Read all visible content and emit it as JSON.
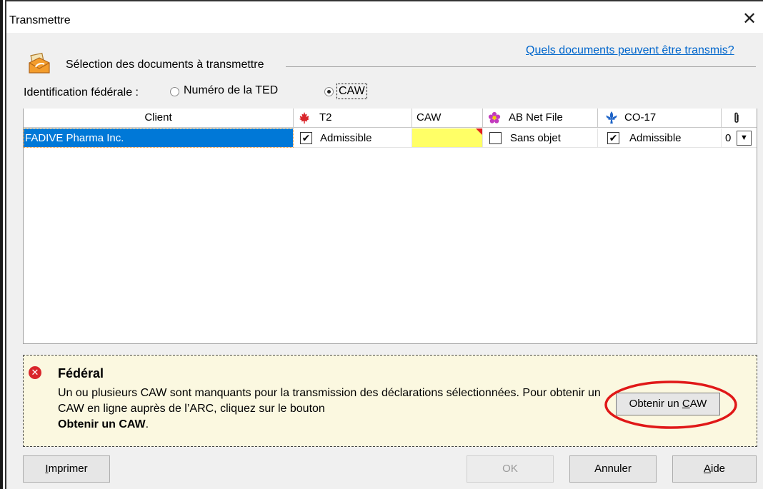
{
  "window": {
    "title": "Transmettre",
    "close_glyph": "✕"
  },
  "section": {
    "title": "Sélection des documents à transmettre",
    "help_link": "Quels documents peuvent être transmis?"
  },
  "identification": {
    "label": "Identification fédérale :",
    "options": [
      "Numéro de la TED",
      "CAW"
    ],
    "selected": "CAW"
  },
  "grid": {
    "headers": {
      "client": "Client",
      "t2": "T2",
      "caw": "CAW",
      "ab_net_file": "AB Net File",
      "co17": "CO-17",
      "attachments_icon": "paperclip-icon"
    },
    "rows": [
      {
        "client": "FADIVE Pharma Inc.",
        "t2_checked": true,
        "t2_status": "Admissible",
        "caw": "",
        "ab_checked": false,
        "ab_status": "Sans objet",
        "co17_checked": true,
        "co17_status": "Admissible",
        "attachments": "0"
      }
    ],
    "colors": {
      "selected_row": "#0078d7",
      "caw_missing": "#ffff66",
      "caw_marker": "#e02020"
    }
  },
  "warning": {
    "title": "Fédéral",
    "message": "Un ou plusieurs CAW sont manquants pour la transmission des déclarations sélectionnées. Pour obtenir un CAW en ligne auprès de l’ARC, cliquez sur le bouton",
    "message_bold": "Obtenir un CAW",
    "message_end": ".",
    "button_prefix": "Obtenir un ",
    "button_accel": "C",
    "button_suffix": "AW",
    "icon": "error-icon",
    "highlight_color": "#e01818"
  },
  "buttons": {
    "print_accel": "I",
    "print_rest": "mprimer",
    "ok": "OK",
    "cancel": "Annuler",
    "help_accel": "A",
    "help_rest": "ide"
  }
}
